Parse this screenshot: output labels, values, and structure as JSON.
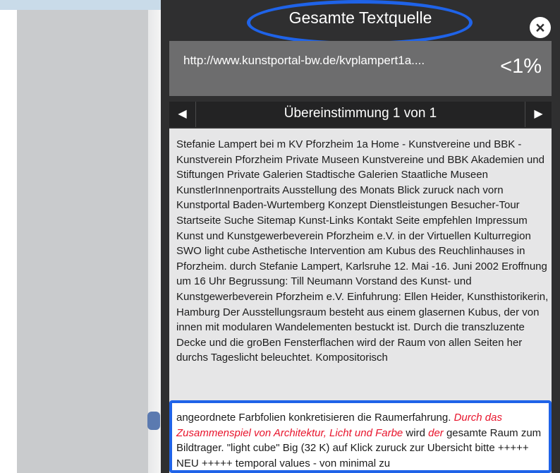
{
  "panel": {
    "title": "Gesamte Textquelle",
    "close_icon": "×"
  },
  "source": {
    "url": "http://www.kunstportal-bw.de/kvplampert1a....",
    "percent": "<1%"
  },
  "match": {
    "label": "Übereinstimmung 1 von 1",
    "prev_arrow": "◀",
    "next_arrow": "▶"
  },
  "text": {
    "body": "Stefanie Lampert bei m KV Pforzheim 1a Home - Kunstvereine und BBK - Kunstverein Pforzheim Private Museen Kunstvereine und BBK Akademien und Stiftungen Private Galerien Stadtische Galerien Staatliche Museen KunstlerInnenportraits Ausstellung des Monats Blick zuruck nach vorn Kunstportal Baden-Wurtemberg Konzept Dienstleistungen Besucher-Tour Startseite Suche Sitemap Kunst-Links Kontakt Seite empfehlen Impressum Kunst und Kunstgewerbeverein Pforzheim e.V. in der Virtuellen Kulturregion SWO light cube Asthetische Intervention am Kubus des Reuchlinhauses in Pforzheim. durch Stefanie Lampert, Karlsruhe 12. Mai -16. Juni 2002 Eroffnung um 16 Uhr Begrussung: Till Neumann Vorstand des Kunst- und Kunstgewerbeverein Pforzheim e.V. Einfuhrung: Ellen Heider, Kunsthistorikerin, Hamburg Der Ausstellungsraum besteht aus einem glasernen Kubus, der von innen mit modularen Wandelementen bestuckt ist. Durch die transzluzente Decke und die groBen Fensterflachen wird der Raum von allen Seiten her durchs Tageslicht beleuchtet. Kompositorisch",
    "highlight_before": "angeordnete Farbfolien konkretisieren die Raumerfahrung. ",
    "highlight_red1": "Durch das Zusammenspiel von Architektur, Licht und Farbe",
    "highlight_mid": " wird ",
    "highlight_red2": "der",
    "highlight_after": " gesamte Raum zum Bildtrager. \"light cube\" Big (32 K) auf Klick zuruck zur Ubersicht bitte +++++ NEU +++++ temporal values - von minimal zu"
  },
  "colors": {
    "panel_bg": "#2f2f30",
    "source_bg": "#6d6d6e",
    "accent_blue": "#1f63e8",
    "match_red": "#e8142c"
  }
}
